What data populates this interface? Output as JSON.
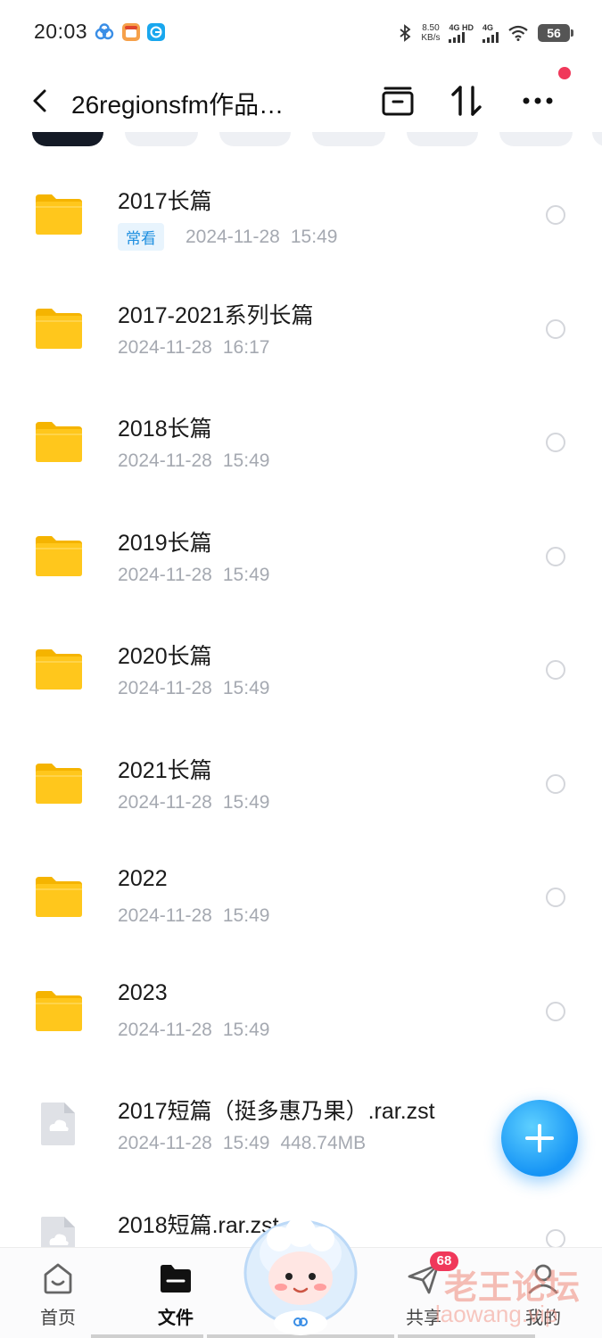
{
  "status_bar": {
    "time": "20:03",
    "net_speed_value": "8.50",
    "net_speed_unit": "KB/s",
    "signal_1_label": "4G HD",
    "signal_2_label": "4G",
    "battery": "56"
  },
  "header": {
    "title": "26regionsfm作品…",
    "back_icon": "chevron-left-icon",
    "actions": [
      "archive-icon",
      "sort-icon",
      "more-icon"
    ]
  },
  "colors": {
    "accent": "#1694f5",
    "tag_bg": "#e8f4fd",
    "tag_text": "#1e8fe0",
    "folder": "#ffc71c",
    "badge": "#f0385a",
    "meta_text": "#a5a9b1"
  },
  "files": [
    {
      "name": "2017长篇",
      "tag": "常看",
      "date": "2024-11-28",
      "time": "15:49",
      "size": "",
      "type": "folder"
    },
    {
      "name": "2017-2021系列长篇",
      "tag": "",
      "date": "2024-11-28",
      "time": "16:17",
      "size": "",
      "type": "folder"
    },
    {
      "name": "2018长篇",
      "tag": "",
      "date": "2024-11-28",
      "time": "15:49",
      "size": "",
      "type": "folder"
    },
    {
      "name": "2019长篇",
      "tag": "",
      "date": "2024-11-28",
      "time": "15:49",
      "size": "",
      "type": "folder"
    },
    {
      "name": "2020长篇",
      "tag": "",
      "date": "2024-11-28",
      "time": "15:49",
      "size": "",
      "type": "folder"
    },
    {
      "name": "2021长篇",
      "tag": "",
      "date": "2024-11-28",
      "time": "15:49",
      "size": "",
      "type": "folder"
    },
    {
      "name": "2022",
      "tag": "",
      "date": "2024-11-28",
      "time": "15:49",
      "size": "",
      "type": "folder"
    },
    {
      "name": "2023",
      "tag": "",
      "date": "2024-11-28",
      "time": "15:49",
      "size": "",
      "type": "folder"
    },
    {
      "name": "2017短篇（挺多惠乃果）.rar.zst",
      "tag": "",
      "date": "2024-11-28",
      "time": "15:49",
      "size": "448.74MB",
      "type": "file"
    },
    {
      "name": "2018短篇.rar.zst",
      "tag": "",
      "date": "",
      "time": "",
      "size": "",
      "type": "file"
    }
  ],
  "bottom_nav": {
    "items": [
      {
        "label": "首页",
        "icon": "home-icon"
      },
      {
        "label": "文件",
        "icon": "folder-icon"
      },
      {
        "label": "共享",
        "icon": "send-icon",
        "badge": "68"
      },
      {
        "label": "我的",
        "icon": "profile-icon"
      }
    ]
  },
  "watermark": {
    "main": "老王论坛",
    "sub": "laowang.vip"
  }
}
